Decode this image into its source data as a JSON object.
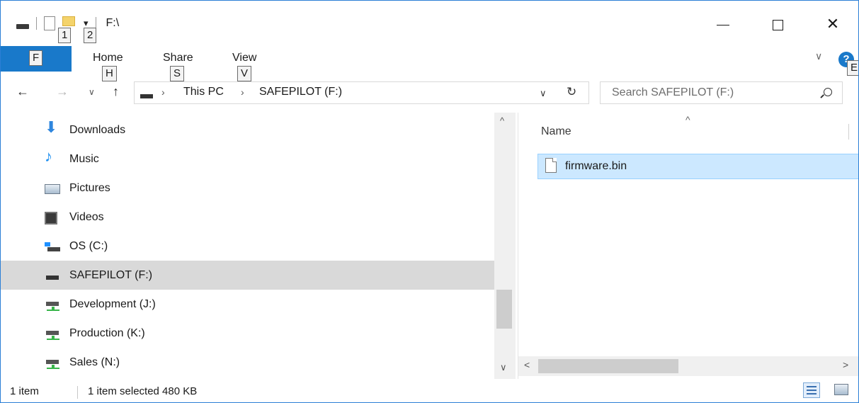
{
  "titlebar": {
    "path": "F:\\",
    "qat_keytips": [
      "1",
      "2"
    ],
    "qat_dropdown": "▾",
    "minimize": "—",
    "close": "✕"
  },
  "ribbon": {
    "file_keytip": "F",
    "tabs": [
      {
        "label": "Home",
        "keytip": "H"
      },
      {
        "label": "Share",
        "keytip": "S"
      },
      {
        "label": "View",
        "keytip": "V"
      }
    ],
    "collapse_chevron": "∨",
    "help_symbol": "?",
    "help_keytip": "E"
  },
  "address": {
    "back": "←",
    "forward": "→",
    "recent": "∨",
    "up": "↑",
    "separator": "›",
    "breadcrumbs": [
      "This PC",
      "SAFEPILOT (F:)"
    ],
    "dropdown": "∨",
    "refresh": "↻",
    "search_placeholder": "Search SAFEPILOT (F:)"
  },
  "navpane": {
    "items": [
      {
        "label": "Downloads",
        "icon": "downloads-icon"
      },
      {
        "label": "Music",
        "icon": "music-icon"
      },
      {
        "label": "Pictures",
        "icon": "pictures-icon"
      },
      {
        "label": "Videos",
        "icon": "videos-icon"
      },
      {
        "label": "OS (C:)",
        "icon": "system-drive-icon"
      },
      {
        "label": "SAFEPILOT (F:)",
        "icon": "drive-icon",
        "selected": true
      },
      {
        "label": "Development (J:)",
        "icon": "network-drive-icon"
      },
      {
        "label": "Production (K:)",
        "icon": "network-drive-icon"
      },
      {
        "label": "Sales (N:)",
        "icon": "network-drive-icon"
      }
    ],
    "scroll_up": "^",
    "scroll_down": "∨"
  },
  "filelist": {
    "sort_arrow": "^",
    "column_name": "Name",
    "files": [
      {
        "name": "firmware.bin",
        "selected": true
      }
    ],
    "scroll_left": "<",
    "scroll_right": ">"
  },
  "statusbar": {
    "item_count": "1 item",
    "selection": "1 item selected  480 KB"
  },
  "colors": {
    "accent": "#1979ca",
    "selection": "#cce8ff",
    "nav_selected": "#d9d9d9"
  }
}
